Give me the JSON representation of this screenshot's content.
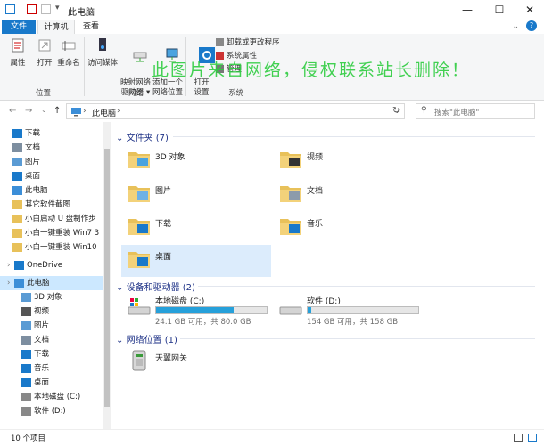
{
  "window": {
    "title": "此电脑",
    "controls": {
      "minimize": "—",
      "maximize": "☐",
      "close": "✕"
    }
  },
  "ribbon_tabs": {
    "file": "文件",
    "computer": "计算机",
    "view": "查看",
    "collapse": "⌄",
    "help": "?"
  },
  "ribbon": {
    "location": {
      "items": [
        "属性",
        "打开",
        "重命名"
      ],
      "label": "位置"
    },
    "network": {
      "items": [
        "访问媒体",
        "映射网络\n驱动器 ▾",
        "添加一个\n网络位置"
      ],
      "label": "网络"
    },
    "system": {
      "open_settings": "打开\n设置",
      "items": [
        "卸载或更改程序",
        "系统属性",
        "管理"
      ],
      "label": "系统"
    }
  },
  "watermark": "此图片来自网络，侵权联系站长删除！",
  "address": {
    "back": "←",
    "forward": "→",
    "recent": "⌄",
    "up": "↑",
    "crumb": "此电脑",
    "sep": "›",
    "refresh": "↻",
    "search_placeholder": "搜索\"此电脑\""
  },
  "nav_items": [
    {
      "label": "下载",
      "pinned": true,
      "icon": "download-icon",
      "color": "#1979ca"
    },
    {
      "label": "文档",
      "pinned": true,
      "icon": "document-icon",
      "color": "#7d8ea0"
    },
    {
      "label": "图片",
      "pinned": true,
      "icon": "picture-icon",
      "color": "#5a9bd4"
    },
    {
      "label": "桌面",
      "pinned": true,
      "icon": "desktop-icon",
      "color": "#1979ca"
    },
    {
      "label": "此电脑",
      "pinned": true,
      "icon": "computer-icon",
      "color": "#3b8ed8"
    },
    {
      "label": "其它软件截图",
      "pinned": false,
      "icon": "folder-icon",
      "color": "#e8c15a"
    },
    {
      "label": "小白启动 U 盘制作步",
      "pinned": false,
      "icon": "folder-icon",
      "color": "#e8c15a"
    },
    {
      "label": "小白一键重装 Win7 3",
      "pinned": false,
      "icon": "folder-icon",
      "color": "#e8c15a"
    },
    {
      "label": "小白一键重装 Win10",
      "pinned": false,
      "icon": "folder-icon",
      "color": "#e8c15a"
    },
    {
      "label": "OneDrive",
      "pinned": false,
      "icon": "onedrive-icon",
      "color": "#1979ca",
      "expand": true
    },
    {
      "label": "此电脑",
      "pinned": false,
      "icon": "computer-icon",
      "color": "#3b8ed8",
      "expand": true,
      "selected": true
    },
    {
      "label": "3D 对象",
      "pinned": false,
      "icon": "3d-objects-icon",
      "color": "#5a9bd4"
    },
    {
      "label": "视频",
      "pinned": false,
      "icon": "video-icon",
      "color": "#555"
    },
    {
      "label": "图片",
      "pinned": false,
      "icon": "picture-icon",
      "color": "#5a9bd4"
    },
    {
      "label": "文档",
      "pinned": false,
      "icon": "document-icon",
      "color": "#7d8ea0"
    },
    {
      "label": "下载",
      "pinned": false,
      "icon": "download-icon",
      "color": "#1979ca"
    },
    {
      "label": "音乐",
      "pinned": false,
      "icon": "music-icon",
      "color": "#1979ca"
    },
    {
      "label": "桌面",
      "pinned": false,
      "icon": "desktop-icon",
      "color": "#1979ca"
    },
    {
      "label": "本地磁盘 (C:)",
      "pinned": false,
      "icon": "drive-c-icon",
      "color": "#888"
    },
    {
      "label": "软件 (D:)",
      "pinned": false,
      "icon": "drive-d-icon",
      "color": "#888"
    }
  ],
  "sections": {
    "folders": "文件夹 (7)",
    "drives": "设备和驱动器 (2)",
    "network": "网络位置 (1)",
    "chevron": "⌄"
  },
  "folders": [
    {
      "label": "3D 对象",
      "icon": "3d-objects-icon"
    },
    {
      "label": "视频",
      "icon": "video-icon"
    },
    {
      "label": "图片",
      "icon": "picture-icon"
    },
    {
      "label": "文档",
      "icon": "document-icon"
    },
    {
      "label": "下载",
      "icon": "download-icon"
    },
    {
      "label": "音乐",
      "icon": "music-icon"
    },
    {
      "label": "桌面",
      "icon": "desktop-icon"
    }
  ],
  "drives": [
    {
      "label": "本地磁盘 (C:)",
      "size": "24.1 GB 可用，共 80.0 GB",
      "used_fraction": 0.7
    },
    {
      "label": "软件 (D:)",
      "size": "154 GB 可用，共 158 GB",
      "used_fraction": 0.03
    }
  ],
  "network_locations": [
    {
      "label": "天翼网关"
    }
  ],
  "status": {
    "count": "10 个项目"
  },
  "colors": {
    "accent": "#1979ca",
    "section": "#1e3287",
    "selection": "#dcecfc",
    "folder": "#e8c15a",
    "drive_fill": "#26a0da",
    "watermark": "#2ecc40"
  }
}
